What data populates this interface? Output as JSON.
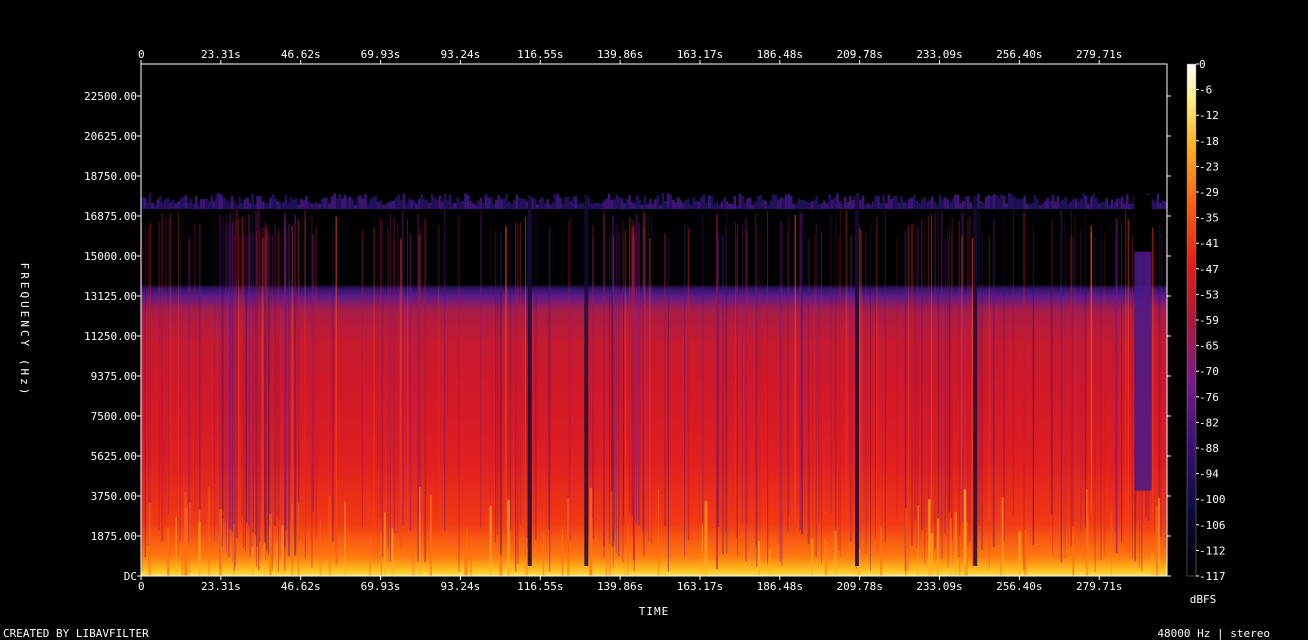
{
  "chart_data": {
    "type": "heatmap",
    "ylabel": "FREQUENCY (Hz)",
    "xlabel": "TIME",
    "x_ticks": [
      "0",
      "23.31s",
      "46.62s",
      "69.93s",
      "93.24s",
      "116.55s",
      "139.86s",
      "163.17s",
      "186.48s",
      "209.78s",
      "233.09s",
      "256.40s",
      "279.71s"
    ],
    "x_tick_values": [
      0,
      23.31,
      46.62,
      69.93,
      93.24,
      116.55,
      139.86,
      163.17,
      186.48,
      209.78,
      233.09,
      256.4,
      279.71
    ],
    "xlim": [
      0,
      299.5
    ],
    "y_ticks": [
      "DC",
      "1875.00",
      "3750.00",
      "5625.00",
      "7500.00",
      "9375.00",
      "11250.00",
      "13125.00",
      "15000.00",
      "16875.00",
      "18750.00",
      "20625.00",
      "22500.00"
    ],
    "y_tick_values": [
      0,
      1875,
      3750,
      5625,
      7500,
      9375,
      11250,
      13125,
      15000,
      16875,
      18750,
      20625,
      22500
    ],
    "ylim": [
      0,
      24000
    ],
    "colorbar": {
      "label": "dBFS",
      "ticks": [
        "0",
        "-6",
        "-12",
        "-18",
        "-23",
        "-29",
        "-35",
        "-41",
        "-47",
        "-53",
        "-59",
        "-65",
        "-70",
        "-76",
        "-82",
        "-88",
        "-94",
        "-100",
        "-106",
        "-112",
        "-117"
      ],
      "range": [
        -120,
        0
      ]
    },
    "content_cutoff_hz": 17200,
    "gaps_seconds": [
      113.5,
      130.0,
      209.0,
      243.5
    ],
    "silent_region_seconds": [
      290,
      295
    ]
  },
  "footer": {
    "left": "CREATED BY LIBAVFILTER",
    "right": "48000 Hz | stereo"
  },
  "colors": {
    "background": "#000000",
    "axis": "#ffffff",
    "palette": [
      "#000000",
      "#0a0a3a",
      "#3c0f7a",
      "#7a1a8c",
      "#c0182e",
      "#e8201a",
      "#ff6a10",
      "#ffc830",
      "#ffffd0",
      "#ffffff"
    ]
  }
}
